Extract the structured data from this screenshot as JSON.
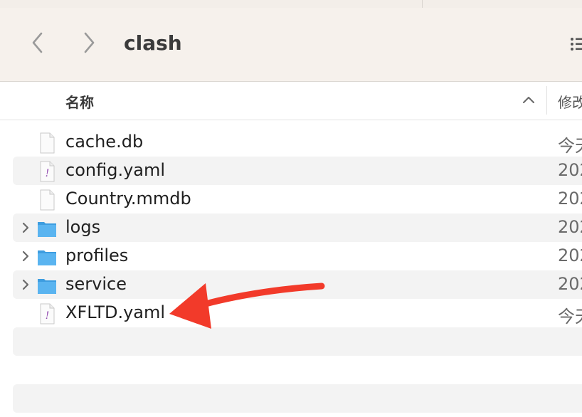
{
  "window": {
    "folder_title": "clash"
  },
  "toolbar": {
    "back_icon": "chevron-left-icon",
    "forward_icon": "chevron-right-icon",
    "view_icon": "list-view-icon"
  },
  "columns": {
    "name": "名称",
    "date_modified": "修改",
    "sort": "ascending"
  },
  "files": [
    {
      "name": "cache.db",
      "date": "今天",
      "kind": "document",
      "expandable": false
    },
    {
      "name": "config.yaml",
      "date": "202",
      "kind": "yaml",
      "expandable": false
    },
    {
      "name": "Country.mmdb",
      "date": "202",
      "kind": "document",
      "expandable": false
    },
    {
      "name": "logs",
      "date": "202",
      "kind": "folder",
      "expandable": true
    },
    {
      "name": "profiles",
      "date": "202",
      "kind": "folder",
      "expandable": true
    },
    {
      "name": "service",
      "date": "202",
      "kind": "folder",
      "expandable": true
    },
    {
      "name": "XFLTD.yaml",
      "date": "今天",
      "kind": "yaml",
      "expandable": false
    }
  ],
  "colors": {
    "toolbar_bg": "#f6f1ec",
    "row_alt": "#f3f3f3",
    "folder": "#5ab4f0",
    "annotation_arrow": "#f23a2a",
    "yaml_mark": "#8e44ad"
  }
}
